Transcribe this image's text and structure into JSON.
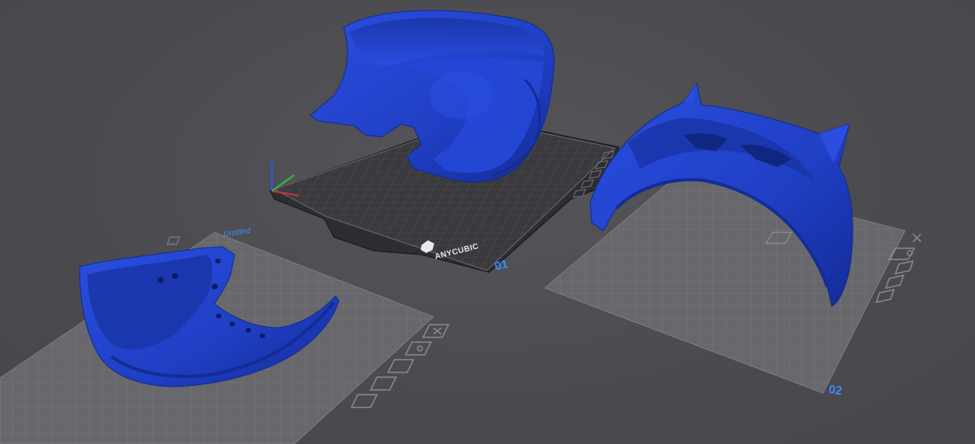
{
  "app": {
    "view": "3d-build-plate-viewport"
  },
  "plates": [
    {
      "label": "01",
      "brand": "ANYCUBIC",
      "color": "#3c3c40"
    },
    {
      "label": "02",
      "color": "#6e6e72"
    },
    {
      "label": "Untitled",
      "color": "#6e6e72"
    }
  ],
  "models": [
    {
      "name": "helmet-back-shell",
      "color": "#1f3fc4"
    },
    {
      "name": "helmet-mask-with-ears",
      "color": "#1f3fc4"
    },
    {
      "name": "helmet-jaw-piece",
      "color": "#1f3fc4"
    }
  ],
  "plate_tools": [
    {
      "name": "close-icon"
    },
    {
      "name": "settings-icon"
    },
    {
      "name": "layers-icon"
    },
    {
      "name": "auto-arrange-icon"
    },
    {
      "name": "lock-icon"
    }
  ],
  "colors": {
    "background": "#4a4a4f",
    "model_blue": "#1f3fc4",
    "model_shadow": "#13288a",
    "label_blue": "#3d8bff",
    "axis_x": "#d03030",
    "axis_y": "#30c040",
    "axis_z": "#3050ff"
  }
}
